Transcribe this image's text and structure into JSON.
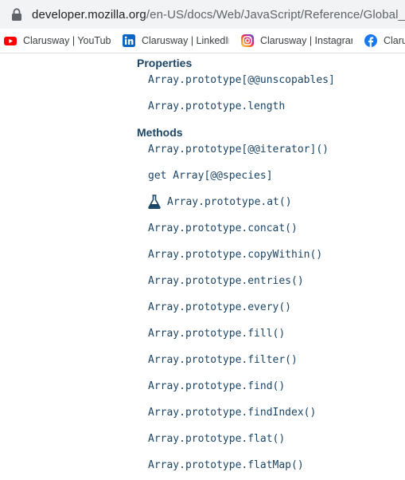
{
  "browser": {
    "url_host": "developer.mozilla.org",
    "url_path": "/en-US/docs/Web/JavaScript/Reference/Global_Objects/Array"
  },
  "bookmarks": [
    {
      "label": "Clarusway | YouTube",
      "icon": "youtube-icon",
      "color": "#ff0000"
    },
    {
      "label": "Clarusway | LinkedIn",
      "icon": "linkedin-icon",
      "color": "#0a66c2"
    },
    {
      "label": "Clarusway | Instagram",
      "icon": "instagram-icon",
      "color": "#d62976"
    },
    {
      "label": "Clarusway | Facebook",
      "icon": "facebook-icon",
      "color": "#1877f2"
    }
  ],
  "sidebar": {
    "properties_heading": "Properties",
    "properties": [
      "Array.prototype[@@unscopables]",
      "Array.prototype.length"
    ],
    "methods_heading": "Methods",
    "methods": [
      "Array.prototype[@@iterator]()",
      "get Array[@@species]",
      "Array.prototype.at()",
      "Array.prototype.concat()",
      "Array.prototype.copyWithin()",
      "Array.prototype.entries()",
      "Array.prototype.every()",
      "Array.prototype.fill()",
      "Array.prototype.filter()",
      "Array.prototype.find()",
      "Array.prototype.findIndex()",
      "Array.prototype.flat()",
      "Array.prototype.flatMap()"
    ],
    "experimental_icon": "flask-icon"
  },
  "colors": {
    "link": "#1b4465",
    "heading": "#1b4465"
  }
}
